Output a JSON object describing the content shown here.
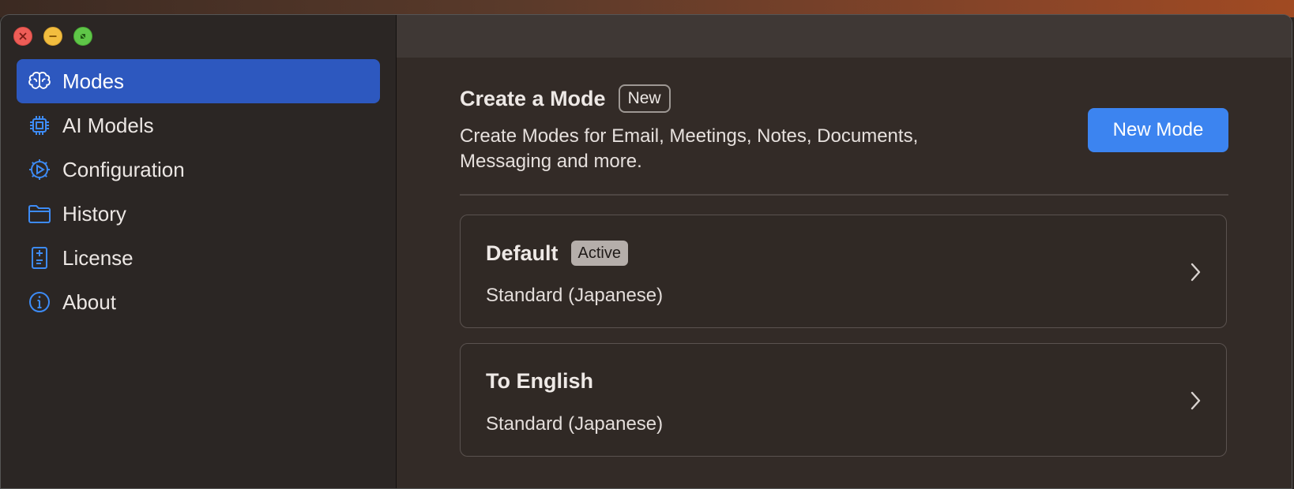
{
  "window": {
    "controls": [
      "close-icon",
      "minimize-icon",
      "fullscreen-icon"
    ]
  },
  "sidebar": {
    "items": [
      {
        "label": "Modes",
        "icon": "brain-icon",
        "active": true
      },
      {
        "label": "AI Models",
        "icon": "chip-icon",
        "active": false
      },
      {
        "label": "Configuration",
        "icon": "gear-icon",
        "active": false
      },
      {
        "label": "History",
        "icon": "folder-icon",
        "active": false
      },
      {
        "label": "License",
        "icon": "document-icon",
        "active": false
      },
      {
        "label": "About",
        "icon": "info-icon",
        "active": false
      }
    ]
  },
  "create": {
    "title": "Create a Mode",
    "badge": "New",
    "description": "Create Modes for Email, Meetings, Notes, Documents, Messaging and more.",
    "button_label": "New Mode"
  },
  "modes": [
    {
      "name": "Default",
      "badge": "Active",
      "subtitle": "Standard (Japanese)"
    },
    {
      "name": "To English",
      "badge": "",
      "subtitle": "Standard (Japanese)"
    }
  ],
  "colors": {
    "accent": "#3c84f0",
    "sidebar_active": "#2d58bf",
    "icon_blue": "#3d8bf5"
  }
}
